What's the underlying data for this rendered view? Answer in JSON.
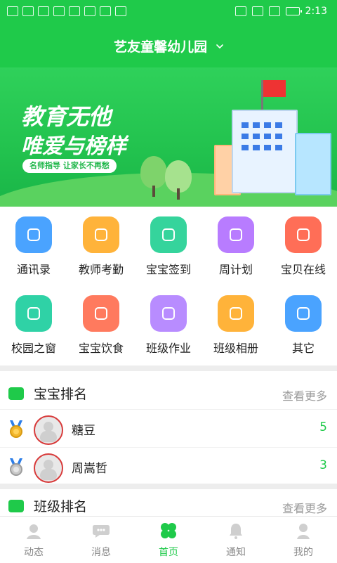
{
  "status_bar": {
    "left_icons": [
      "hd-icon",
      "signal-4g-icon",
      "signal-4g-icon",
      "wifi-icon",
      "wechat-icon",
      "app-icon",
      "app-icon",
      "translate-icon"
    ],
    "right_icons": [
      "eye-icon",
      "alarm-icon",
      "mute-icon",
      "battery-icon"
    ],
    "time": "2:13"
  },
  "header": {
    "title": "艺友童馨幼儿园"
  },
  "banner": {
    "slogan_line1": "教育无他",
    "slogan_line2": "唯爱与榜样",
    "tagline": "名师指导 让家长不再愁"
  },
  "features": [
    {
      "label": "通讯录",
      "icon": "contacts-icon",
      "color": "#4aa3ff"
    },
    {
      "label": "教师考勤",
      "icon": "teacher-attendance-icon",
      "color": "#ffb33a"
    },
    {
      "label": "宝宝签到",
      "icon": "checkin-icon",
      "color": "#35d49c"
    },
    {
      "label": "周计划",
      "icon": "week-plan-icon",
      "color": "#b87cff"
    },
    {
      "label": "宝贝在线",
      "icon": "video-icon",
      "color": "#ff6e57"
    },
    {
      "label": "校园之窗",
      "icon": "campus-icon",
      "color": "#2fd2a6"
    },
    {
      "label": "宝宝饮食",
      "icon": "meal-icon",
      "color": "#ff7a5e"
    },
    {
      "label": "班级作业",
      "icon": "homework-icon",
      "color": "#b88cff"
    },
    {
      "label": "班级相册",
      "icon": "album-icon",
      "color": "#ffb33a"
    },
    {
      "label": "其它",
      "icon": "more-grid-icon",
      "color": "#4aa3ff"
    }
  ],
  "baby_ranking": {
    "title": "宝宝排名",
    "more": "查看更多",
    "rows": [
      {
        "name": "糖豆",
        "score": "5",
        "medal": "gold-medal-icon"
      },
      {
        "name": "周嵩哲",
        "score": "3",
        "medal": "silver-medal-icon"
      }
    ]
  },
  "class_ranking": {
    "title": "班级排名",
    "more": "查看更多"
  },
  "tabs": [
    {
      "label": "动态",
      "icon": "feed-icon",
      "active": false
    },
    {
      "label": "消息",
      "icon": "message-icon",
      "active": false
    },
    {
      "label": "首页",
      "icon": "home-icon",
      "active": true
    },
    {
      "label": "通知",
      "icon": "bell-icon",
      "active": false
    },
    {
      "label": "我的",
      "icon": "profile-icon",
      "active": false
    }
  ],
  "colors": {
    "brand_green": "#1fca4a",
    "tab_inactive": "#8a8a8a",
    "muted_text": "#9a9a9a"
  }
}
